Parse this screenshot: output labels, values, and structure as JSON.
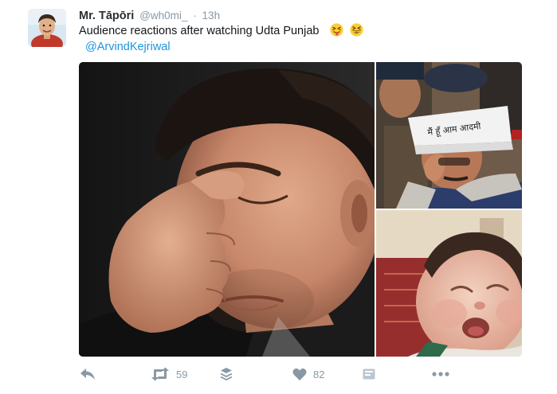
{
  "tweet": {
    "display_name": "Mr. Tāpōri",
    "handle": "@wh0mi_",
    "separator": "·",
    "timestamp": "13h",
    "text": "Audience reactions after watching Udta Punjab",
    "emojis": [
      "squinting-tongue-emoji",
      "grinning-squinting-emoji"
    ],
    "mention": "@ArvindKejriwal",
    "cap_text": "मैं हूँ आम आदमी"
  },
  "actions": {
    "reply": {
      "icon": "reply-icon"
    },
    "retweet": {
      "icon": "retweet-icon",
      "count": "59"
    },
    "buffer": {
      "icon": "stack-icon"
    },
    "like": {
      "icon": "heart-icon",
      "count": "82"
    },
    "dm": {
      "icon": "message-icon"
    },
    "more": {
      "icon": "more-dots-icon"
    }
  },
  "colors": {
    "name": "#292f33",
    "meta": "#8899a6",
    "link": "#1b95e0",
    "text": "#14171a"
  }
}
